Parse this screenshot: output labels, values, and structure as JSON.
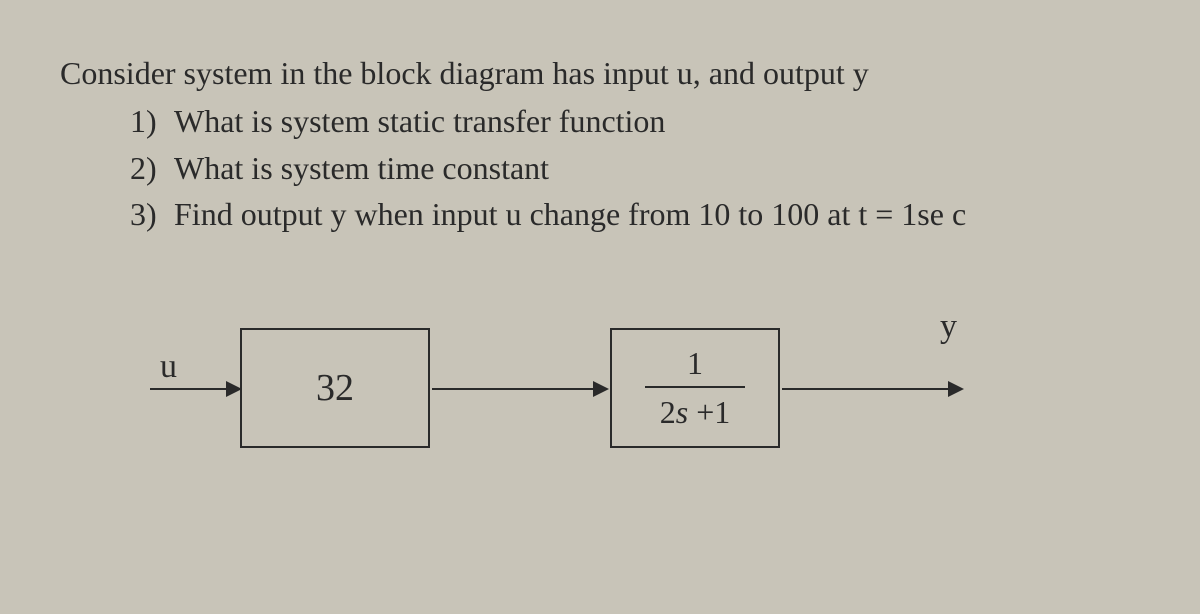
{
  "problem": {
    "statement": "Consider system in the block diagram has input u, and output y",
    "questions": [
      {
        "num": "1)",
        "text": "What is system static transfer function"
      },
      {
        "num": "2)",
        "text": "What is system time constant"
      },
      {
        "num": "3)",
        "text": "Find output y when input u change from 10 to 100 at t = 1se c"
      }
    ]
  },
  "diagram": {
    "input_label": "u",
    "output_label": "y",
    "block1_value": "32",
    "block2_numerator": "1",
    "block2_denom_coeff": "2",
    "block2_denom_var": "s",
    "block2_denom_plus": " +1"
  }
}
